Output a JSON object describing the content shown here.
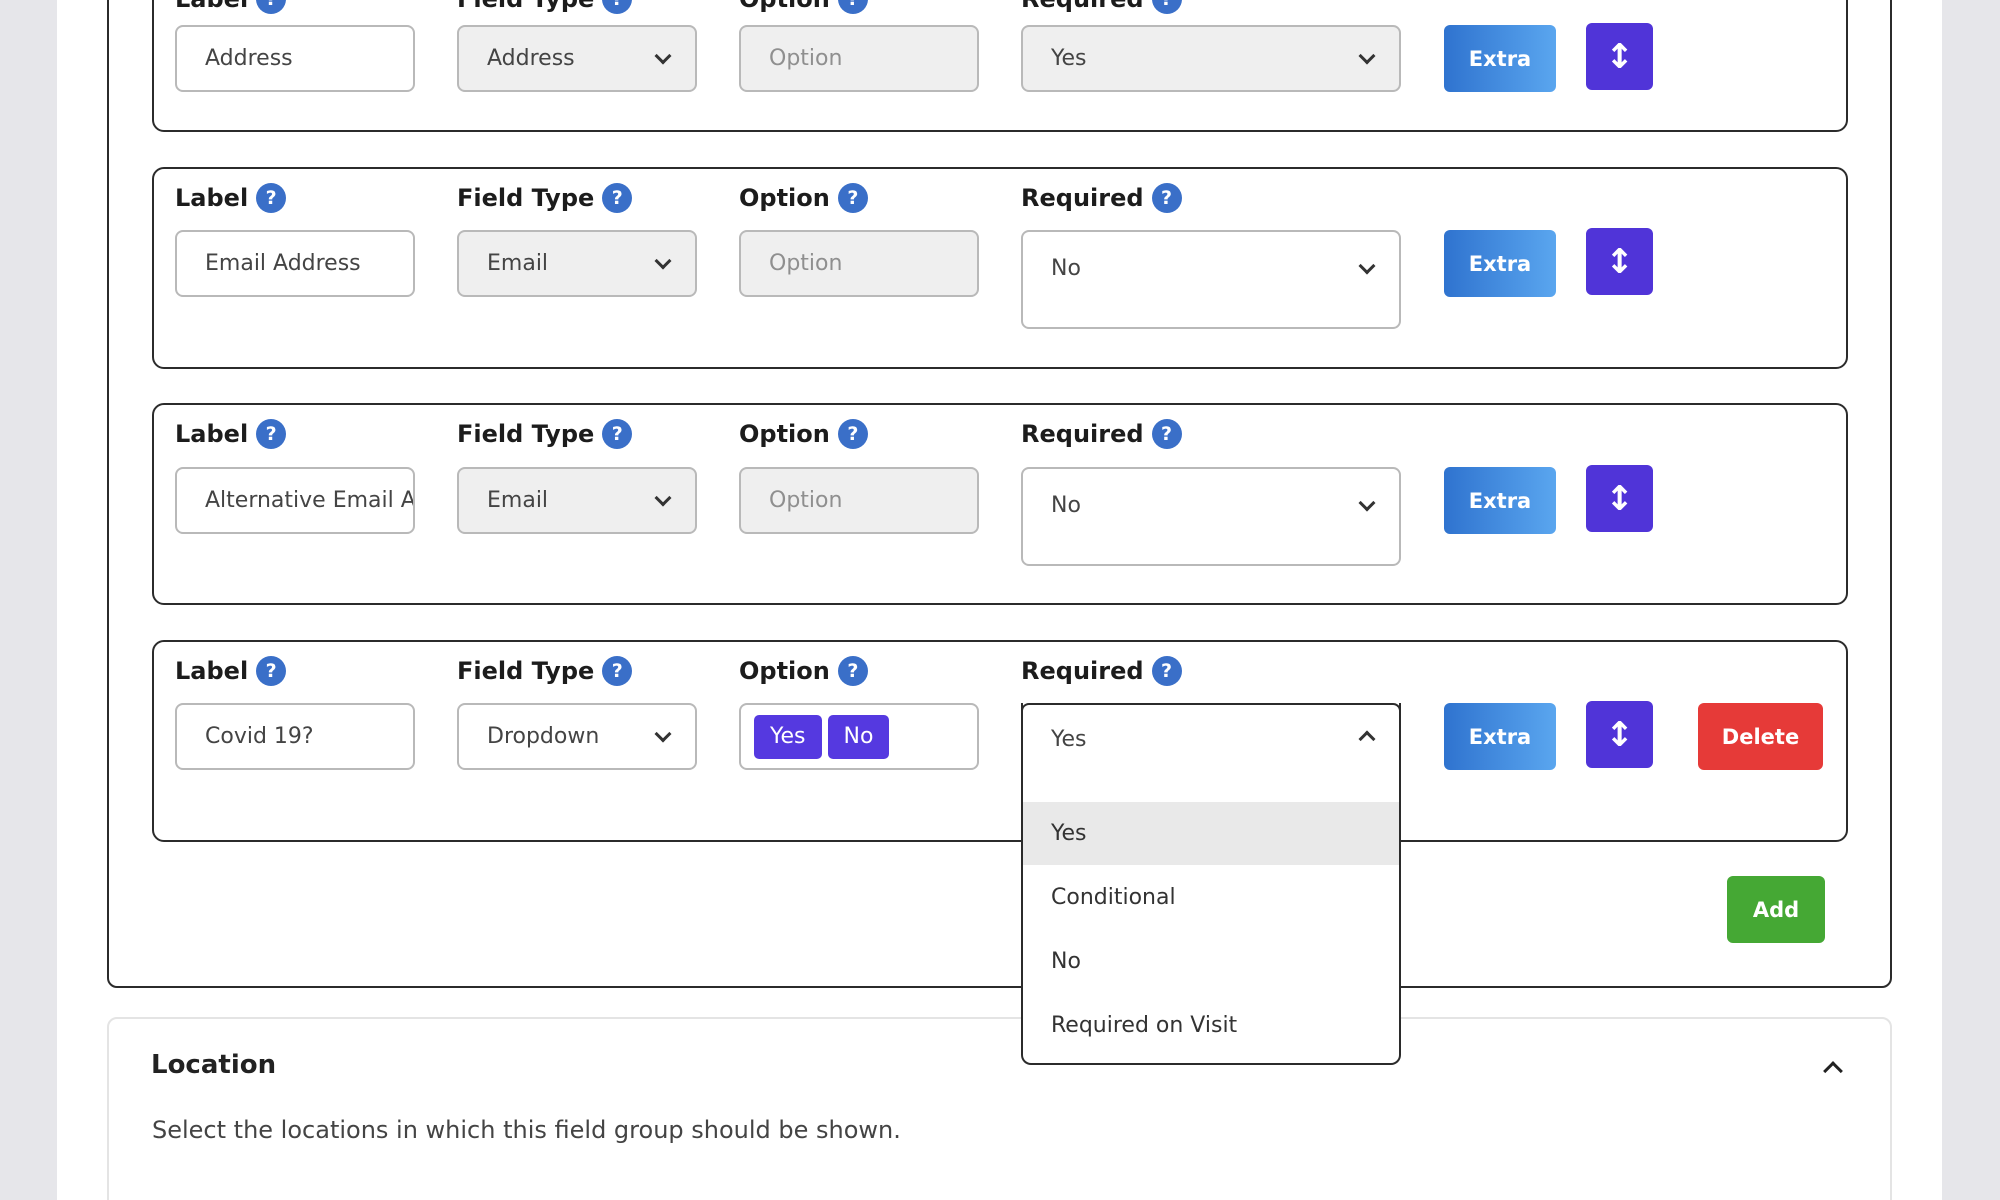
{
  "common": {
    "label_header": "Label",
    "field_type_header": "Field Type",
    "option_header": "Option",
    "required_header": "Required",
    "help_glyph": "?",
    "extra_button": "Extra",
    "move_glyph": "↕",
    "option_placeholder": "Option"
  },
  "rows": [
    {
      "label_value": "Address",
      "field_type": "Address",
      "required": "Yes"
    },
    {
      "label_value": "Email Address",
      "field_type": "Email",
      "required": "No"
    },
    {
      "label_value": "Alternative Email Address",
      "field_type": "Email",
      "required": "No"
    },
    {
      "label_value": "Covid 19?",
      "field_type": "Dropdown",
      "options": [
        "Yes",
        "No"
      ],
      "required": "Yes",
      "delete_button": "Delete"
    }
  ],
  "required_dropdown": {
    "open": true,
    "selected": "Yes",
    "options": [
      "Yes",
      "Conditional",
      "No",
      "Required on Visit"
    ]
  },
  "add_button": "Add",
  "location": {
    "title": "Location",
    "description": "Select the locations in which this field group should be shown."
  },
  "colors": {
    "extra_gradient": [
      "#2f73cf",
      "#5aa6ef"
    ],
    "move_button": "#5034d8",
    "delete_button": "#e63a38",
    "add_button": "#45a834",
    "help_icon": "#3a6fc8",
    "option_chip": "#5539e0"
  },
  "icons": [
    "help-icon",
    "chevron-down-icon",
    "chevron-up-icon",
    "move-arrows-icon"
  ]
}
